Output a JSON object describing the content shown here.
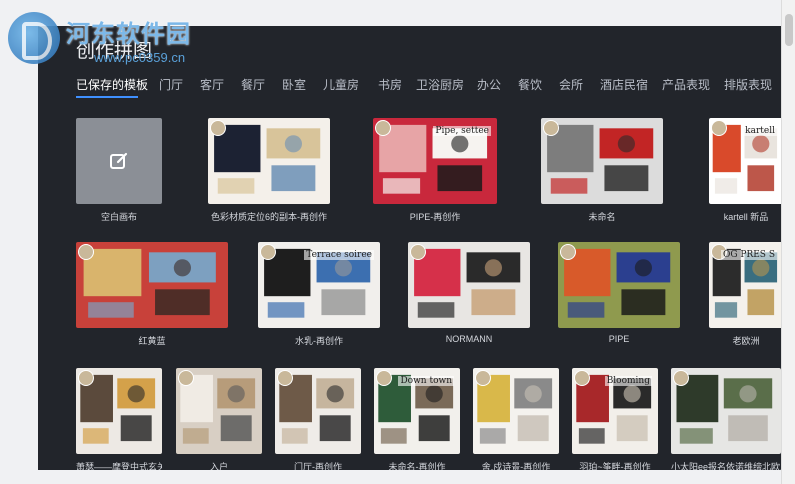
{
  "watermark": {
    "text": "河东软件园",
    "url": "www.pc0359.cn"
  },
  "title": "创作拼图",
  "tabs": [
    "已保存的模板",
    "门厅",
    "客厅",
    "餐厅",
    "卧室",
    "儿童房",
    "书房",
    "卫浴厨房",
    "办公",
    "餐饮",
    "会所",
    "酒店民宿",
    "产品表现",
    "排版表现"
  ],
  "active_tab": 0,
  "cards": [
    {
      "caption": "空白画布",
      "kind": "blank"
    },
    {
      "caption": "色彩材质定位6的副本-再创作",
      "colors": [
        "#f4f0ea",
        "#1c2233",
        "#d8c49a",
        "#6a8fb5"
      ]
    },
    {
      "caption": "PIPE-再创作",
      "colors": [
        "#c9283c",
        "#e7a4a6",
        "#f6f3f0",
        "#1a1a1a"
      ],
      "overlay_text": "Pipe, settee"
    },
    {
      "caption": "未命名",
      "colors": [
        "#dcdcdc",
        "#7d7d7d",
        "#c22525",
        "#2b2b2b"
      ]
    },
    {
      "caption": "kartell 新品",
      "colors": [
        "#ffffff",
        "#d94a2b",
        "#e9e4de",
        "#b23a2a"
      ],
      "overlay_text": "kartell"
    },
    {
      "caption": "红黄蓝",
      "colors": [
        "#c8413a",
        "#d9b46c",
        "#7da0c0",
        "#3a2a25"
      ]
    },
    {
      "caption": "水乳-再创作",
      "colors": [
        "#f1efec",
        "#1e1e1e",
        "#3c6fb0",
        "#9a9a9a"
      ],
      "overlay_text": "Terrace soiree"
    },
    {
      "caption": "NORMANN",
      "colors": [
        "#e8e6e3",
        "#d6304a",
        "#2a2a2a",
        "#c8a27a"
      ]
    },
    {
      "caption": "PIPE",
      "colors": [
        "#8f9a4e",
        "#d85a2a",
        "#2b3f8f",
        "#1a1a1a"
      ]
    },
    {
      "caption": "老欧洲",
      "colors": [
        "#f4f1ec",
        "#2c2c2c",
        "#3a6e80",
        "#b8954e"
      ],
      "overlay_text": "OG PRES S"
    },
    {
      "caption": "萧瑟——摩登中式玄关...",
      "colors": [
        "#ede9e4",
        "#5b4a3c",
        "#d4a14a",
        "#2a2a2a"
      ]
    },
    {
      "caption": "入户",
      "colors": [
        "#d8cfc4",
        "#f0ebe4",
        "#b79c7a",
        "#5a5a5a"
      ]
    },
    {
      "caption": "门厅-再创作",
      "colors": [
        "#efece8",
        "#6e5a48",
        "#c6b59e",
        "#2c2c2c"
      ]
    },
    {
      "caption": "未命名-再创作",
      "colors": [
        "#f2f0ec",
        "#2e5c3a",
        "#7a6a58",
        "#1e1e1e"
      ],
      "overlay_text": "Down town"
    },
    {
      "caption": "舍.戍诗景-再创作",
      "colors": [
        "#f4f2ee",
        "#d9b84a",
        "#8a8a8a",
        "#c8c1b6"
      ]
    },
    {
      "caption": "羽珀~筝畔-再创作",
      "colors": [
        "#f2efea",
        "#a8282a",
        "#2a2a2a",
        "#cfc6b8"
      ],
      "overlay_text": "Blooming"
    },
    {
      "caption": "小太阳ee报名依诺维缔北欧风",
      "colors": [
        "#e6e6e4",
        "#2e3a2a",
        "#5a6e4a",
        "#b8b4ae"
      ]
    }
  ]
}
